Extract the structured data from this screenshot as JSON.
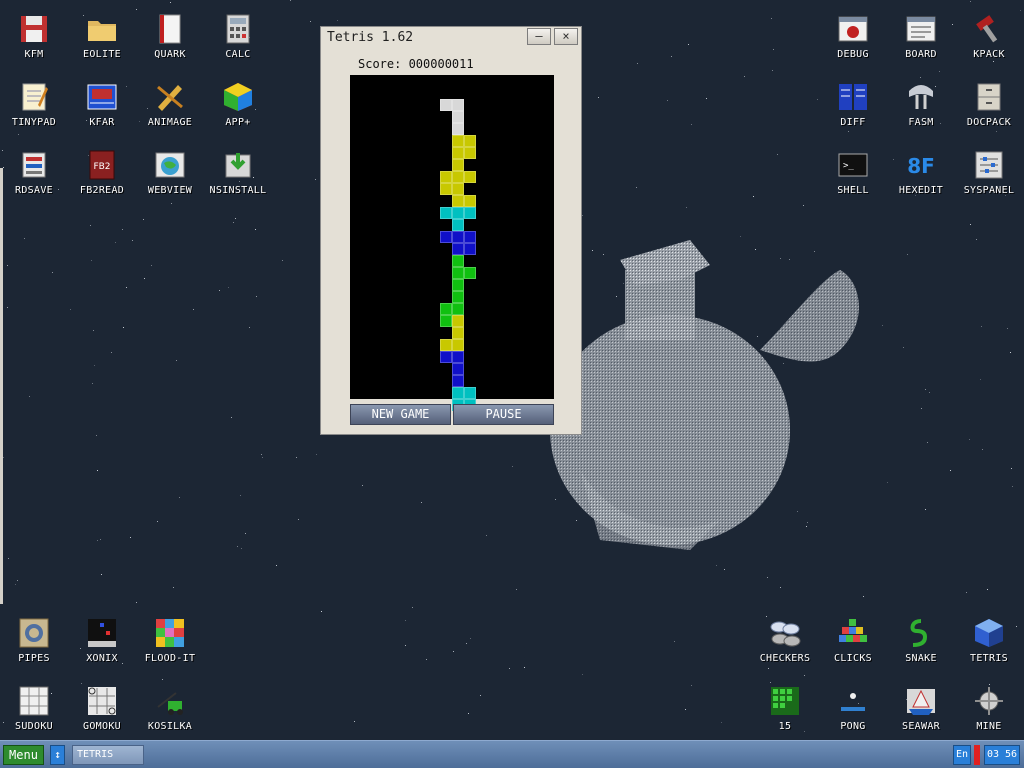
{
  "desktop": {
    "icons_top_left": [
      {
        "label": "KFM",
        "icon": "floppy-disk-icon"
      },
      {
        "label": "EOLITE",
        "icon": "folder-icon"
      },
      {
        "label": "QUARK",
        "icon": "notebook-icon"
      },
      {
        "label": "CALC",
        "icon": "calculator-icon"
      },
      {
        "label": "TINYPAD",
        "icon": "notepad-icon"
      },
      {
        "label": "KFAR",
        "icon": "archive-panel-icon"
      },
      {
        "label": "ANIMAGE",
        "icon": "pencil-brush-icon"
      },
      {
        "label": "APP+",
        "icon": "rubik-cube-icon"
      },
      {
        "label": "RDSAVE",
        "icon": "rd-save-icon"
      },
      {
        "label": "FB2READ",
        "icon": "fb2-book-icon"
      },
      {
        "label": "WEBVIEW",
        "icon": "globe-window-icon"
      },
      {
        "label": "NSINSTALL",
        "icon": "installer-icon"
      }
    ],
    "icons_top_right": [
      {
        "label": "DEBUG",
        "icon": "bug-window-icon"
      },
      {
        "label": "BOARD",
        "icon": "board-window-icon"
      },
      {
        "label": "KPACK",
        "icon": "hammer-icon"
      },
      {
        "label": "DIFF",
        "icon": "diff-table-icon"
      },
      {
        "label": "FASM",
        "icon": "fasm-cable-icon"
      },
      {
        "label": "DOCPACK",
        "icon": "cabinet-icon"
      },
      {
        "label": "SHELL",
        "icon": "terminal-icon"
      },
      {
        "label": "HEXEDIT",
        "icon": "hex-8f-icon"
      },
      {
        "label": "SYSPANEL",
        "icon": "sliders-icon"
      }
    ],
    "icons_bottom_left": [
      {
        "label": "PIPES",
        "icon": "pipes-icon"
      },
      {
        "label": "XONIX",
        "icon": "xonix-icon"
      },
      {
        "label": "FLOOD-IT",
        "icon": "flood-grid-icon"
      },
      {
        "label": "SUDOKU",
        "icon": "sudoku-grid-icon"
      },
      {
        "label": "GOMOKU",
        "icon": "tic-tac-toe-icon"
      },
      {
        "label": "KOSILKA",
        "icon": "lawnmower-icon"
      }
    ],
    "icons_bottom_right": [
      {
        "label": "CHECKERS",
        "icon": "checkers-icon"
      },
      {
        "label": "CLICKS",
        "icon": "blocks-icon"
      },
      {
        "label": "SNAKE",
        "icon": "snake-icon"
      },
      {
        "label": "TETRIS",
        "icon": "tetris-cube-icon"
      },
      {
        "label": "15",
        "icon": "fifteen-grid-icon"
      },
      {
        "label": "PONG",
        "icon": "pong-icon"
      },
      {
        "label": "SEAWAR",
        "icon": "ship-icon"
      },
      {
        "label": "MINE",
        "icon": "mine-icon"
      }
    ]
  },
  "tetris": {
    "title": "Tetris 1.62",
    "minimize_label": "—",
    "close_label": "×",
    "score_label": "Score: 000000011",
    "new_game_label": "NEW GAME",
    "pause_label": "PAUSE",
    "colors": {
      "W": "#d8d8d8",
      "Y": "#c8c800",
      "C": "#00c0c0",
      "B": "#1010c8",
      "G": "#10c010"
    },
    "grid": [
      ".......WW.......",
      "........W.......",
      "........W.......",
      "........YY......",
      "........YY......",
      "........Y.......",
      ".......YYY......",
      ".......YY.......",
      "........YY......",
      ".......CCC......",
      "........C.......",
      ".......BBB......",
      "........BB......",
      "........G.......",
      "........GG......",
      "........G.......",
      "........G.......",
      ".......GG.......",
      ".......GY.......",
      "........Y.......",
      ".......YY.......",
      ".......BB.......",
      "........B.......",
      "........B.......",
      "........CC......",
      "........CC......"
    ]
  },
  "taskbar": {
    "menu_label": "Menu",
    "switch_label": "↕",
    "task_label": "TETRIS",
    "lang_label": "En",
    "clock_label": "03 56"
  }
}
